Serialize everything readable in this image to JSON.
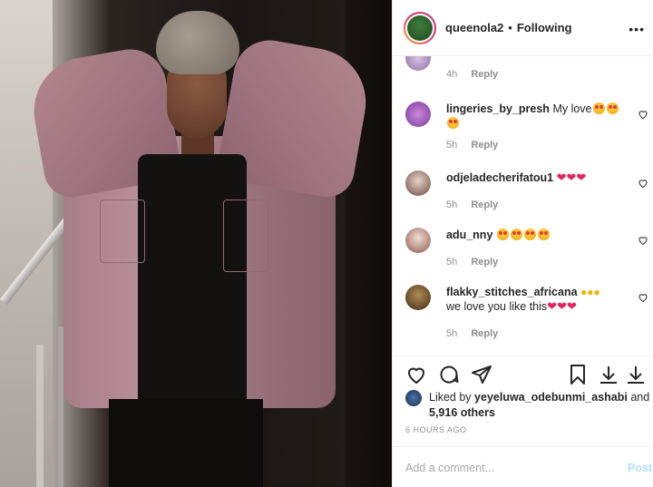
{
  "post": {
    "author": "queenola2",
    "separator": "•",
    "follow_state": "Following",
    "more_glyph": "•••"
  },
  "comments": [
    {
      "user": "",
      "text": "",
      "time": "4h",
      "reply": "Reply",
      "liked": false
    },
    {
      "user": "lingeries_by_presh",
      "text": "My love",
      "time": "5h",
      "reply": "Reply",
      "emoji": "heart-eyes x3"
    },
    {
      "user": "odjeladecherifatou1",
      "text": "",
      "time": "5h",
      "reply": "Reply",
      "emoji": "red-heart x3"
    },
    {
      "user": "adu_nny",
      "text": "",
      "time": "5h",
      "reply": "Reply",
      "emoji": "heart-eyes x4"
    },
    {
      "user": "flakky_stitches_africana",
      "text": "we love you like this",
      "time": "5h",
      "reply": "Reply",
      "emoji": "flexed-biceps x3, red-heart x3"
    }
  ],
  "likes": {
    "prefix": "Liked by",
    "user": "yeyeluwa_odebunmi_ashabi",
    "and": "and",
    "count": "5,916 others"
  },
  "timestamp": "6 HOURS AGO",
  "add_comment": {
    "placeholder": "Add a comment...",
    "post_label": "Post"
  },
  "icons": [
    "heart-icon",
    "comment-icon",
    "share-icon",
    "bookmark-icon",
    "download-icon",
    "download-icon-2",
    "more-icon"
  ],
  "colors": {
    "accent_link": "#b2dffc",
    "text": "#262626",
    "muted": "#8e8e8e",
    "heart": "#e0245e"
  }
}
